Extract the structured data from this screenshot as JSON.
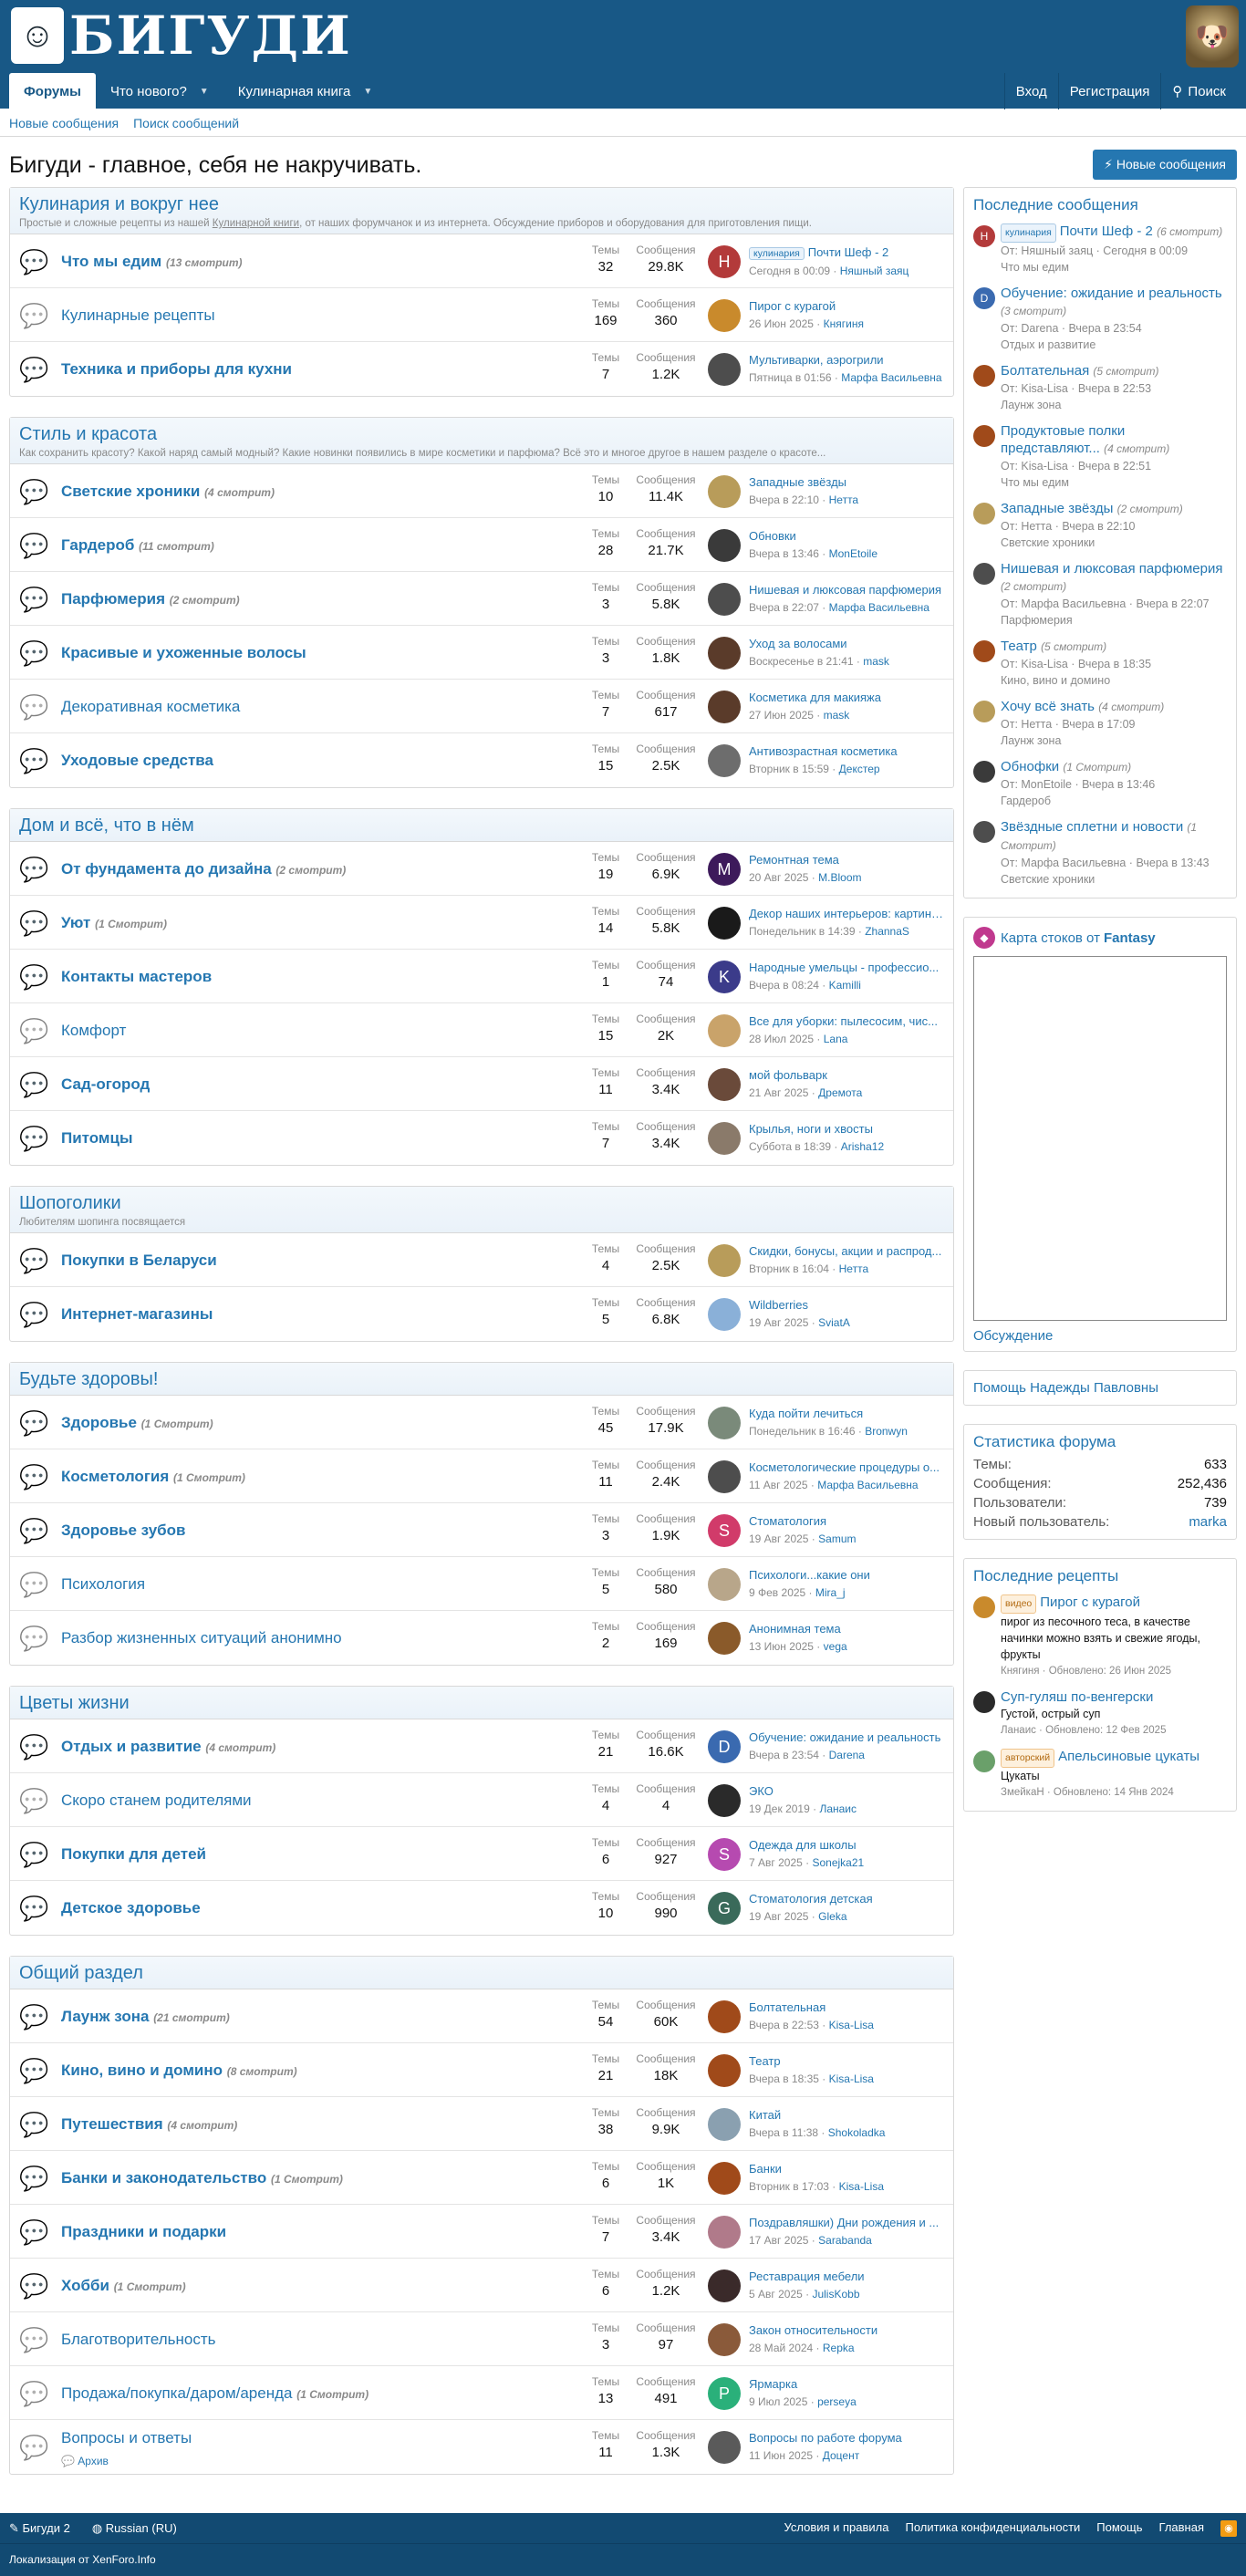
{
  "header": {
    "logo_text": "БИГУДИ",
    "title": "Бигуди - главное, себя не накручивать.",
    "new_posts_btn": "Новые сообщения"
  },
  "nav": {
    "tabs": [
      {
        "label": "Форумы",
        "active": true
      },
      {
        "label": "Что нового?",
        "dropdown": true
      },
      {
        "label": "Кулинарная книга",
        "dropdown": true
      }
    ],
    "login": "Вход",
    "register": "Регистрация",
    "search": "Поиск"
  },
  "subnav": {
    "new_messages": "Новые сообщения",
    "search_messages": "Поиск сообщений"
  },
  "stat_labels": {
    "threads": "Темы",
    "messages": "Сообщения"
  },
  "categories": [
    {
      "title": "Кулинария и вокруг нее",
      "desc_pre": "Простые и сложные рецепты из нашей ",
      "desc_link": "Кулинарной книги",
      "desc_post": ", от наших форумчанок и из интернета. Обсуждение приборов и оборудования для приготовления пищи.",
      "nodes": [
        {
          "title": "Что мы едим",
          "viewing": "(13 смотрит)",
          "unread": true,
          "threads": "32",
          "messages": "29.8K",
          "last_prefix": "кулинария",
          "last_title": "Почти Шеф - 2",
          "last_date": "Сегодня в 00:09",
          "last_user": "Няшный заяц",
          "av": "Н",
          "avc": "#b33a3a"
        },
        {
          "title": "Кулинарные рецепты",
          "viewing": "",
          "unread": false,
          "threads": "169",
          "messages": "360",
          "last_prefix": "",
          "last_title": "Пирог с курагой",
          "last_date": "26 Июн 2025",
          "last_user": "Княгиня",
          "av": "",
          "avc": "#c98a2c"
        },
        {
          "title": "Техника и приборы для кухни",
          "viewing": "",
          "unread": true,
          "threads": "7",
          "messages": "1.2K",
          "last_prefix": "",
          "last_title": "Мультиварки, аэрогрили",
          "last_date": "Пятница в 01:56",
          "last_user": "Марфа Васильевна",
          "av": "",
          "avc": "#4d4d4d"
        }
      ]
    },
    {
      "title": "Стиль и красота",
      "desc_pre": "Как сохранить красоту? Какой наряд самый модный? Какие новинки появились в мире косметики и парфюма? Всё это и многое другое в нашем разделе о красоте...",
      "desc_link": "",
      "desc_post": "",
      "nodes": [
        {
          "title": "Светские хроники",
          "viewing": "(4 смотрит)",
          "unread": true,
          "threads": "10",
          "messages": "11.4K",
          "last_prefix": "",
          "last_title": "Западные звёзды",
          "last_date": "Вчера в 22:10",
          "last_user": "Нетта",
          "av": "",
          "avc": "#b89c5a"
        },
        {
          "title": "Гардероб",
          "viewing": "(11 смотрит)",
          "unread": true,
          "threads": "28",
          "messages": "21.7K",
          "last_prefix": "",
          "last_title": "Обновки",
          "last_date": "Вчера в 13:46",
          "last_user": "MonEtoile",
          "av": "",
          "avc": "#3a3a3a"
        },
        {
          "title": "Парфюмерия",
          "viewing": "(2 смотрит)",
          "unread": true,
          "threads": "3",
          "messages": "5.8K",
          "last_prefix": "",
          "last_title": "Нишевая и люксовая парфюмерия",
          "last_date": "Вчера в 22:07",
          "last_user": "Марфа Васильевна",
          "av": "",
          "avc": "#4d4d4d"
        },
        {
          "title": "Красивые и ухоженные волосы",
          "viewing": "",
          "unread": true,
          "threads": "3",
          "messages": "1.8K",
          "last_prefix": "",
          "last_title": "Уход за волосами",
          "last_date": "Воскресенье в 21:41",
          "last_user": "mask",
          "av": "",
          "avc": "#5a3b2a"
        },
        {
          "title": "Декоративная косметика",
          "viewing": "",
          "unread": false,
          "threads": "7",
          "messages": "617",
          "last_prefix": "",
          "last_title": "Косметика для макияжа",
          "last_date": "27 Июн 2025",
          "last_user": "mask",
          "av": "",
          "avc": "#5a3b2a"
        },
        {
          "title": "Уходовые средства",
          "viewing": "",
          "unread": true,
          "threads": "15",
          "messages": "2.5K",
          "last_prefix": "",
          "last_title": "Антивозрастная косметика",
          "last_date": "Вторник в 15:59",
          "last_user": "Декстер",
          "av": "",
          "avc": "#6d6d6d"
        }
      ]
    },
    {
      "title": "Дом и всё, что в нём",
      "desc_pre": "",
      "desc_link": "",
      "desc_post": "",
      "nodes": [
        {
          "title": "От фундамента до дизайна",
          "viewing": "(2 смотрит)",
          "unread": true,
          "threads": "19",
          "messages": "6.9K",
          "last_prefix": "",
          "last_title": "Ремонтная тема",
          "last_date": "20 Авг 2025",
          "last_user": "M.Bloom",
          "av": "M",
          "avc": "#3d1a5b"
        },
        {
          "title": "Уют",
          "viewing": "(1 Смотрит)",
          "unread": true,
          "threads": "14",
          "messages": "5.8K",
          "last_prefix": "",
          "last_title": "Декор наших интерьеров: картины...",
          "last_date": "Понедельник в 14:39",
          "last_user": "ZhannaS",
          "av": "",
          "avc": "#1a1a1a"
        },
        {
          "title": "Контакты мастеров",
          "viewing": "",
          "unread": true,
          "threads": "1",
          "messages": "74",
          "last_prefix": "",
          "last_title": "Народные умельцы - профессио...",
          "last_date": "Вчера в 08:24",
          "last_user": "Kamilli",
          "av": "K",
          "avc": "#3b3b8a"
        },
        {
          "title": "Комфорт",
          "viewing": "",
          "unread": false,
          "threads": "15",
          "messages": "2K",
          "last_prefix": "",
          "last_title": "Все для уборки: пылесосим, чис...",
          "last_date": "28 Июл 2025",
          "last_user": "Lana",
          "av": "",
          "avc": "#c9a36a"
        },
        {
          "title": "Сад-огород",
          "viewing": "",
          "unread": true,
          "threads": "11",
          "messages": "3.4K",
          "last_prefix": "",
          "last_title": "мой фольварк",
          "last_date": "21 Авг 2025",
          "last_user": "Дремота",
          "av": "",
          "avc": "#6a4a3a"
        },
        {
          "title": "Питомцы",
          "viewing": "",
          "unread": true,
          "threads": "7",
          "messages": "3.4K",
          "last_prefix": "",
          "last_title": "Крылья, ноги и хвосты",
          "last_date": "Суббота в 18:39",
          "last_user": "Arisha12",
          "av": "",
          "avc": "#8a7a6a"
        }
      ]
    },
    {
      "title": "Шопоголики",
      "desc_pre": "Любителям шопинга посвящается",
      "desc_link": "",
      "desc_post": "",
      "nodes": [
        {
          "title": "Покупки в Беларуси",
          "viewing": "",
          "unread": true,
          "threads": "4",
          "messages": "2.5K",
          "last_prefix": "",
          "last_title": "Скидки, бонусы, акции и распрод...",
          "last_date": "Вторник в 16:04",
          "last_user": "Нетта",
          "av": "",
          "avc": "#b89c5a"
        },
        {
          "title": "Интернет-магазины",
          "viewing": "",
          "unread": true,
          "threads": "5",
          "messages": "6.8K",
          "last_prefix": "",
          "last_title": "Wildberries",
          "last_date": "19 Авг 2025",
          "last_user": "SviatA",
          "av": "",
          "avc": "#8ab0d8"
        }
      ]
    },
    {
      "title": "Будьте здоровы!",
      "desc_pre": "",
      "desc_link": "",
      "desc_post": "",
      "nodes": [
        {
          "title": "Здоровье",
          "viewing": "(1 Смотрит)",
          "unread": true,
          "threads": "45",
          "messages": "17.9K",
          "last_prefix": "",
          "last_title": "Куда пойти лечиться",
          "last_date": "Понедельник в 16:46",
          "last_user": "Bronwyn",
          "av": "",
          "avc": "#7a8a7a"
        },
        {
          "title": "Косметология",
          "viewing": "(1 Смотрит)",
          "unread": true,
          "threads": "11",
          "messages": "2.4K",
          "last_prefix": "",
          "last_title": "Косметологические процедуры о...",
          "last_date": "11 Авг 2025",
          "last_user": "Марфа Васильевна",
          "av": "",
          "avc": "#4d4d4d"
        },
        {
          "title": "Здоровье зубов",
          "viewing": "",
          "unread": true,
          "threads": "3",
          "messages": "1.9K",
          "last_prefix": "",
          "last_title": "Стоматология",
          "last_date": "19 Авг 2025",
          "last_user": "Samum",
          "av": "S",
          "avc": "#d13b6a"
        },
        {
          "title": "Психология",
          "viewing": "",
          "unread": false,
          "threads": "5",
          "messages": "580",
          "last_prefix": "",
          "last_title": "Психологи...какие они",
          "last_date": "9 Фев 2025",
          "last_user": "Mira_j",
          "av": "",
          "avc": "#b8a68a"
        },
        {
          "title": "Разбор жизненных ситуаций анонимно",
          "viewing": "",
          "unread": false,
          "threads": "2",
          "messages": "169",
          "last_prefix": "",
          "last_title": "Анонимная тема",
          "last_date": "13 Июн 2025",
          "last_user": "vega",
          "av": "",
          "avc": "#8a5a2a"
        }
      ]
    },
    {
      "title": "Цветы жизни",
      "desc_pre": "",
      "desc_link": "",
      "desc_post": "",
      "nodes": [
        {
          "title": "Отдых и развитие",
          "viewing": "(4 смотрит)",
          "unread": true,
          "threads": "21",
          "messages": "16.6K",
          "last_prefix": "",
          "last_title": "Обучение: ожидание и реальность",
          "last_date": "Вчера в 23:54",
          "last_user": "Darena",
          "av": "D",
          "avc": "#3a6ab0"
        },
        {
          "title": "Скоро станем родителями",
          "viewing": "",
          "unread": false,
          "threads": "4",
          "messages": "4",
          "last_prefix": "",
          "last_title": "ЭКО",
          "last_date": "19 Дек 2019",
          "last_user": "Ланаис",
          "av": "",
          "avc": "#2a2a2a"
        },
        {
          "title": "Покупки для детей",
          "viewing": "",
          "unread": true,
          "threads": "6",
          "messages": "927",
          "last_prefix": "",
          "last_title": "Одежда для школы",
          "last_date": "7 Авг 2025",
          "last_user": "Sonejka21",
          "av": "S",
          "avc": "#b64ab0"
        },
        {
          "title": "Детское здоровье",
          "viewing": "",
          "unread": true,
          "threads": "10",
          "messages": "990",
          "last_prefix": "",
          "last_title": "Стоматология детская",
          "last_date": "19 Авг 2025",
          "last_user": "Gleka",
          "av": "G",
          "avc": "#3a6a5a"
        }
      ]
    },
    {
      "title": "Общий раздел",
      "desc_pre": "",
      "desc_link": "",
      "desc_post": "",
      "nodes": [
        {
          "title": "Лаунж зона",
          "viewing": "(21 смотрит)",
          "unread": true,
          "threads": "54",
          "messages": "60K",
          "last_prefix": "",
          "last_title": "Болтательная",
          "last_date": "Вчера в 22:53",
          "last_user": "Kisa-Lisa",
          "av": "",
          "avc": "#a04a1a"
        },
        {
          "title": "Кино, вино и домино",
          "viewing": "(8 смотрит)",
          "unread": true,
          "threads": "21",
          "messages": "18K",
          "last_prefix": "",
          "last_title": "Театр",
          "last_date": "Вчера в 18:35",
          "last_user": "Kisa-Lisa",
          "av": "",
          "avc": "#a04a1a"
        },
        {
          "title": "Путешествия",
          "viewing": "(4 смотрит)",
          "unread": true,
          "threads": "38",
          "messages": "9.9K",
          "last_prefix": "",
          "last_title": "Китай",
          "last_date": "Вчера в 11:38",
          "last_user": "Shokoladka",
          "av": "",
          "avc": "#8aa0b0"
        },
        {
          "title": "Банки и законодательство",
          "viewing": "(1 Смотрит)",
          "unread": true,
          "threads": "6",
          "messages": "1K",
          "last_prefix": "",
          "last_title": "Банки",
          "last_date": "Вторник в 17:03",
          "last_user": "Kisa-Lisa",
          "av": "",
          "avc": "#a04a1a"
        },
        {
          "title": "Праздники и подарки",
          "viewing": "",
          "unread": true,
          "threads": "7",
          "messages": "3.4K",
          "last_prefix": "",
          "last_title": "Поздравляшки) Дни рождения и ...",
          "last_date": "17 Авг 2025",
          "last_user": "Sarabanda",
          "av": "",
          "avc": "#b07a8a"
        },
        {
          "title": "Хобби",
          "viewing": "(1 Смотрит)",
          "unread": true,
          "threads": "6",
          "messages": "1.2K",
          "last_prefix": "",
          "last_title": "Реставрация мебели",
          "last_date": "5 Авг 2025",
          "last_user": "JulisKobb",
          "av": "",
          "avc": "#3a2a2a"
        },
        {
          "title": "Благотворительность",
          "viewing": "",
          "unread": false,
          "threads": "3",
          "messages": "97",
          "last_prefix": "",
          "last_title": "Закон относительности",
          "last_date": "28 Май 2024",
          "last_user": "Repka",
          "av": "",
          "avc": "#8a5a3a"
        },
        {
          "title": "Продажа/покупка/даром/аренда",
          "viewing": "(1 Смотрит)",
          "unread": false,
          "threads": "13",
          "messages": "491",
          "last_prefix": "",
          "last_title": "Ярмарка",
          "last_date": "9 Июл 2025",
          "last_user": "perseya",
          "av": "P",
          "avc": "#2ab07a"
        },
        {
          "title": "Вопросы и ответы",
          "viewing": "",
          "unread": false,
          "sub": "Архив",
          "threads": "11",
          "messages": "1.3K",
          "last_prefix": "",
          "last_title": "Вопросы по работе форума",
          "last_date": "11 Июн 2025",
          "last_user": "Доцент",
          "av": "",
          "avc": "#5a5a5a"
        }
      ]
    }
  ],
  "sidebar": {
    "latest_title": "Последние сообщения",
    "latest": [
      {
        "prefix": "кулинария",
        "title": "Почти Шеф - 2",
        "viewing": "(6 смотрит)",
        "meta": "От: Няшный заяц · Сегодня в 00:09",
        "forum": "Что мы едим",
        "av": "Н",
        "avc": "#b33a3a"
      },
      {
        "prefix": "",
        "title": "Обучение: ожидание и реальность",
        "viewing": "(3 смотрит)",
        "meta": "От: Darena · Вчера в 23:54",
        "forum": "Отдых и развитие",
        "av": "D",
        "avc": "#3a6ab0"
      },
      {
        "prefix": "",
        "title": "Болтательная",
        "viewing": "(5 смотрит)",
        "meta": "От: Kisa-Lisa · Вчера в 22:53",
        "forum": "Лаунж зона",
        "av": "",
        "avc": "#a04a1a"
      },
      {
        "prefix": "",
        "title": "Продуктовые полки представляют...",
        "viewing": "(4 смотрит)",
        "meta": "От: Kisa-Lisa · Вчера в 22:51",
        "forum": "Что мы едим",
        "av": "",
        "avc": "#a04a1a"
      },
      {
        "prefix": "",
        "title": "Западные звёзды",
        "viewing": "(2 смотрит)",
        "meta": "От: Нетта · Вчера в 22:10",
        "forum": "Светские хроники",
        "av": "",
        "avc": "#b89c5a"
      },
      {
        "prefix": "",
        "title": "Нишевая и люксовая парфюмерия",
        "viewing": "(2 смотрит)",
        "meta": "От: Марфа Васильевна · Вчера в 22:07",
        "forum": "Парфюмерия",
        "av": "",
        "avc": "#4d4d4d"
      },
      {
        "prefix": "",
        "title": "Театр",
        "viewing": "(5 смотрит)",
        "meta": "От: Kisa-Lisa · Вчера в 18:35",
        "forum": "Кино, вино и домино",
        "av": "",
        "avc": "#a04a1a"
      },
      {
        "prefix": "",
        "title": "Хочу всё знать",
        "viewing": "(4 смотрит)",
        "meta": "От: Нетта · Вчера в 17:09",
        "forum": "Лаунж зона",
        "av": "",
        "avc": "#b89c5a"
      },
      {
        "prefix": "",
        "title": "Обнофки",
        "viewing": "(1 Смотрит)",
        "meta": "От: MonEtoile · Вчера в 13:46",
        "forum": "Гардероб",
        "av": "",
        "avc": "#3a3a3a"
      },
      {
        "prefix": "",
        "title": "Звёздные сплетни и новости",
        "viewing": "(1 Смотрит)",
        "meta": "От: Марфа Васильевна · Вчера в 13:43",
        "forum": "Светские хроники",
        "av": "",
        "avc": "#4d4d4d"
      }
    ],
    "fantasy_pre": "Карта стоков от",
    "fantasy_bold": "Fantasy",
    "fantasy_link": "Обсуждение",
    "help": "Помощь Надежды Павловны",
    "stats_title": "Статистика форума",
    "stats": [
      {
        "k": "Темы:",
        "v": "633"
      },
      {
        "k": "Сообщения:",
        "v": "252,436"
      },
      {
        "k": "Пользователи:",
        "v": "739"
      },
      {
        "k": "Новый пользователь:",
        "v": "marka"
      }
    ],
    "recipes_title": "Последние рецепты",
    "recipes": [
      {
        "prefix": "видео",
        "title": "Пирог с курагой",
        "desc": "пирог из песочного теса, в качестве начинки можно взять и свежие ягоды, фрукты",
        "meta": "Княгиня · Обновлено: 26 Июн 2025",
        "av": "",
        "avc": "#c98a2c"
      },
      {
        "prefix": "",
        "title": "Суп-гуляш по-венгерски",
        "desc": "Густой, острый суп",
        "meta": "Ланаис · Обновлено: 12 Фев 2025",
        "av": "",
        "avc": "#2a2a2a"
      },
      {
        "prefix": "авторский",
        "title": "Апельсиновые цукаты",
        "desc": "Цукаты",
        "meta": "ЗмейкаН · Обновлено: 14 Янв 2024",
        "av": "",
        "avc": "#6aa06a"
      }
    ]
  },
  "footer": {
    "brand": "Бигуди 2",
    "lang": "Russian (RU)",
    "links": [
      "Условия и правила",
      "Политика конфиденциальности",
      "Помощь",
      "Главная"
    ],
    "credit": "Локализация от XenForo.Info"
  }
}
